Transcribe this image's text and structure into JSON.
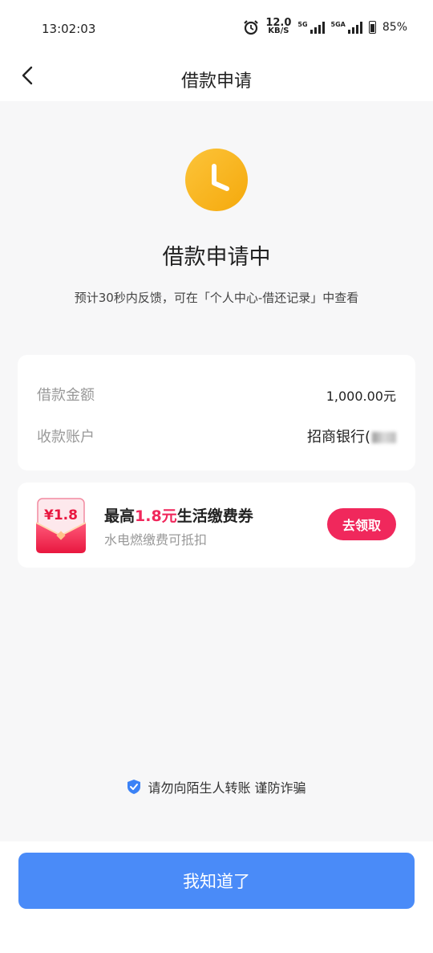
{
  "status_bar": {
    "time": "13:02:03",
    "speed_value": "12.0",
    "speed_unit": "KB/S",
    "network1": "5G",
    "network2": "5GA",
    "battery": "85%"
  },
  "nav": {
    "title": "借款申请"
  },
  "status": {
    "heading": "借款申请中",
    "subtitle": "预计30秒内反馈，可在「个人中心-借还记录」中查看"
  },
  "loan_info": {
    "amount_label": "借款金额",
    "amount_value": "1,000.00元",
    "account_label": "收款账户",
    "account_value": "招商银行("
  },
  "coupon": {
    "badge": "¥1.8",
    "title_prefix": "最高",
    "title_amount": "1.8元",
    "title_suffix": "生活缴费券",
    "subtitle": "水电燃缴费可抵扣",
    "button": "去领取"
  },
  "fraud_notice": "请勿向陌生人转账 谨防诈骗",
  "confirm_button": "我知道了",
  "colors": {
    "accent_blue": "#4a8bf8",
    "accent_red": "#f0285c",
    "clock_yellow": "#fcc43a"
  }
}
